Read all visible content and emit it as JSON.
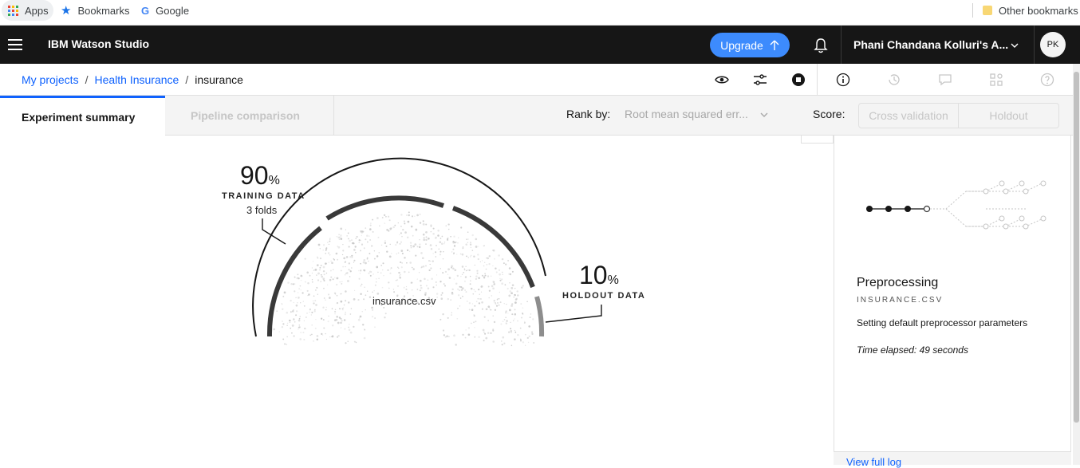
{
  "bookmarks_bar": {
    "apps": "Apps",
    "bookmarks": "Bookmarks",
    "google": "Google",
    "google_letter": "G",
    "other": "Other bookmarks"
  },
  "header": {
    "product": "IBM Watson Studio",
    "upgrade_label": "Upgrade",
    "account": "Phani Chandana Kolluri's A...",
    "avatar_initials": "PK"
  },
  "breadcrumb": {
    "items": [
      "My projects",
      "Health Insurance",
      "insurance"
    ],
    "separator": "/"
  },
  "tabs": {
    "active": "Experiment summary",
    "inactive": "Pipeline comparison"
  },
  "controls": {
    "rank_label": "Rank by:",
    "rank_value": "Root mean squared err...",
    "score_label": "Score:",
    "score_options": [
      "Cross validation",
      "Holdout"
    ]
  },
  "split": {
    "training_value": "90",
    "training_unit": "%",
    "training_label": "TRAINING DATA",
    "training_folds": "3 folds",
    "holdout_value": "10",
    "holdout_unit": "%",
    "holdout_label": "HOLDOUT DATA",
    "file": "insurance.csv"
  },
  "side_panel": {
    "stage": "Preprocessing",
    "file": "INSURANCE.CSV",
    "message": "Setting default preprocessor parameters",
    "time_elapsed": "Time elapsed: 49 seconds",
    "view_log": "View full log"
  },
  "colors": {
    "accent": "#0f62fe",
    "upgrade": "#3d8bfd",
    "topbar": "#161616"
  }
}
